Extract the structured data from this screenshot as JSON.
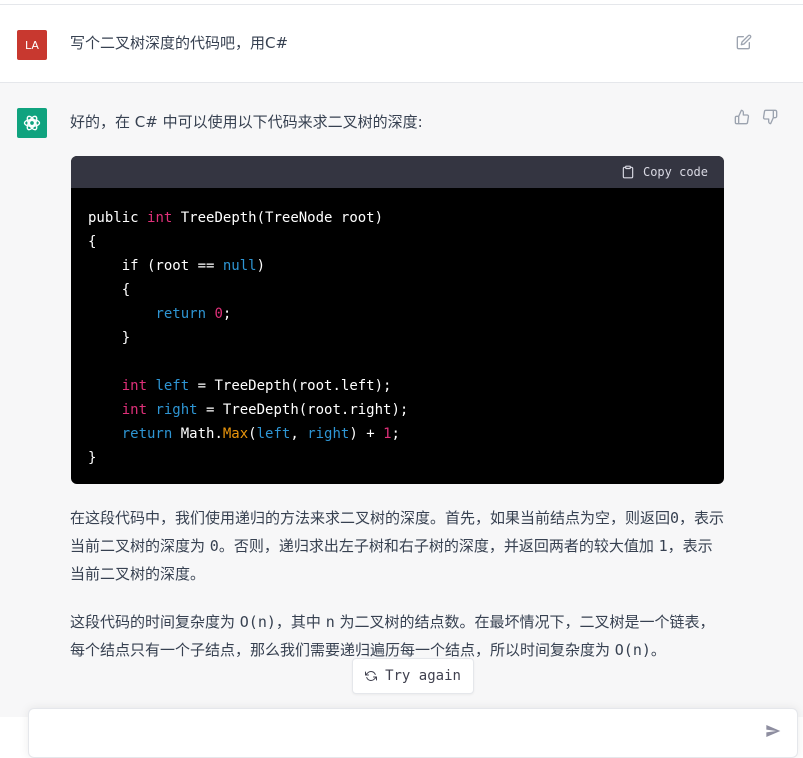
{
  "user": {
    "avatar_text": "LA",
    "message": "写个二叉树深度的代码吧，用C#"
  },
  "assistant": {
    "intro": "好的，在 C# 中可以使用以下代码来求二叉树的深度:",
    "code": {
      "copy_label": "Copy code",
      "lines": [
        [
          {
            "t": "public ",
            "c": ""
          },
          {
            "t": "int",
            "c": "kw-red"
          },
          {
            "t": " TreeDepth(TreeNode root)",
            "c": ""
          }
        ],
        [
          {
            "t": "{",
            "c": ""
          }
        ],
        [
          {
            "t": "    if (root == ",
            "c": ""
          },
          {
            "t": "null",
            "c": "kw-blue"
          },
          {
            "t": ")",
            "c": ""
          }
        ],
        [
          {
            "t": "    {",
            "c": ""
          }
        ],
        [
          {
            "t": "        ",
            "c": ""
          },
          {
            "t": "return",
            "c": "kw-blue"
          },
          {
            "t": " ",
            "c": ""
          },
          {
            "t": "0",
            "c": "kw-red"
          },
          {
            "t": ";",
            "c": ""
          }
        ],
        [
          {
            "t": "    }",
            "c": ""
          }
        ],
        [
          {
            "t": "",
            "c": ""
          }
        ],
        [
          {
            "t": "    ",
            "c": ""
          },
          {
            "t": "int",
            "c": "kw-red"
          },
          {
            "t": " ",
            "c": ""
          },
          {
            "t": "left",
            "c": "kw-blue"
          },
          {
            "t": " = TreeDepth(root.left);",
            "c": ""
          }
        ],
        [
          {
            "t": "    ",
            "c": ""
          },
          {
            "t": "int",
            "c": "kw-red"
          },
          {
            "t": " ",
            "c": ""
          },
          {
            "t": "right",
            "c": "kw-blue"
          },
          {
            "t": " = TreeDepth(root.right);",
            "c": ""
          }
        ],
        [
          {
            "t": "    ",
            "c": ""
          },
          {
            "t": "return",
            "c": "kw-blue"
          },
          {
            "t": " Math.",
            "c": ""
          },
          {
            "t": "Max",
            "c": "fn-orange"
          },
          {
            "t": "(",
            "c": ""
          },
          {
            "t": "left",
            "c": "kw-blue"
          },
          {
            "t": ", ",
            "c": ""
          },
          {
            "t": "right",
            "c": "kw-blue"
          },
          {
            "t": ") + ",
            "c": ""
          },
          {
            "t": "1",
            "c": "kw-red"
          },
          {
            "t": ";",
            "c": ""
          }
        ],
        [
          {
            "t": "}",
            "c": ""
          }
        ]
      ]
    },
    "para1": {
      "a": "在这段代码中，我们使用递归的方法来求二叉树的深度。首先，如果当前结点为空，则返回",
      "b": "0",
      "c": "，表示当前二叉树的深度为 ",
      "d": "0",
      "e": "。否则，递归求出左子树和右子树的深度，并返回两者的较大值加 ",
      "f": "1",
      "g": "，表示当前二叉树的深度。"
    },
    "para2": {
      "a": "这段代码的时间复杂度为 ",
      "b": "O(n)",
      "c": "，其中 ",
      "d": "n",
      "e": " 为二叉树的结点数。在最坏情况下，二叉树是一个链表，每个结点只有一个子结点，那么我们需要递归遍历每一个结点，所以时间复杂度为 ",
      "f": "O(n)",
      "g": "。"
    }
  },
  "try_again_label": "Try again",
  "input": {
    "placeholder": ""
  },
  "colors": {
    "user_avatar": "#c8382f",
    "gpt_avatar": "#10a37f",
    "code_bg": "#000000",
    "code_header": "#343541"
  }
}
